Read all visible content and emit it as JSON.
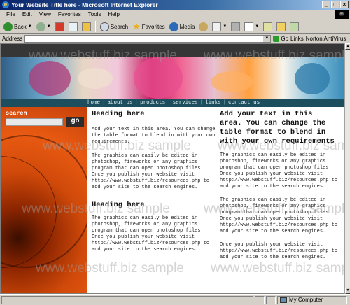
{
  "window": {
    "title": "Your Website Title here - Microsoft Internet Explorer",
    "controls": [
      "_",
      "□",
      "×"
    ]
  },
  "menubar": {
    "items": [
      "File",
      "Edit",
      "View",
      "Favorites",
      "Tools",
      "Help"
    ]
  },
  "toolbar": {
    "back_label": "Back",
    "search_label": "Search",
    "favorites_label": "Favorites",
    "media_label": "Media"
  },
  "addressbar": {
    "label": "Address",
    "go_label": "Go",
    "links_label": "Links",
    "norton_label": "Norton AntiVirus"
  },
  "page": {
    "nav": [
      "home",
      "about us",
      "products",
      "services",
      "links",
      "contact us"
    ],
    "search": {
      "label": "search",
      "button": "go",
      "value": ""
    },
    "col1": {
      "heading1": "Heading here",
      "para1": "Add your text in this area. You can change the table format to blend in with your own requirements.",
      "para2": "The graphics can easily be edited in photoshop, fireworks or any graphics program that can open photoshop files. Once you publish your website visit http://www.webstuff.biz/resources.php to add your site to the search engines.",
      "heading2": "Heading here",
      "para3": "The graphics can easily be edited in photoshop, fireworks or any graphics program that can open photoshop files. Once you publish your website visit http://www.webstuff.biz/resources.php to add your site to the search engines."
    },
    "col2": {
      "heading": "Add your text in this area. You can change the table format to blend in with your own requirements",
      "para1": "The graphics can easily be edited in photoshop, fireworks or any graphics program that can open photoshop files. Once you publish your website visit http://www.webstuff.biz/resources.php to add your site to the search engines.",
      "para2": "The graphics can easily be edited in photoshop, fireworks or any graphics program that can open photoshop files. Once you publish your website visit http://www.webstuff.biz/resources.php to add your site to the search engines.",
      "para3": "Once you publish your website visit http://www.webstuff.biz/resources.php to add your site to the search engines."
    },
    "watermark": "www.webstuff.biz sample"
  },
  "statusbar": {
    "zone": "My Computer"
  },
  "colors": {
    "titlebar": "#0a246a",
    "navbar": "#1c4e5e",
    "leftcol": "#d14a0a"
  }
}
